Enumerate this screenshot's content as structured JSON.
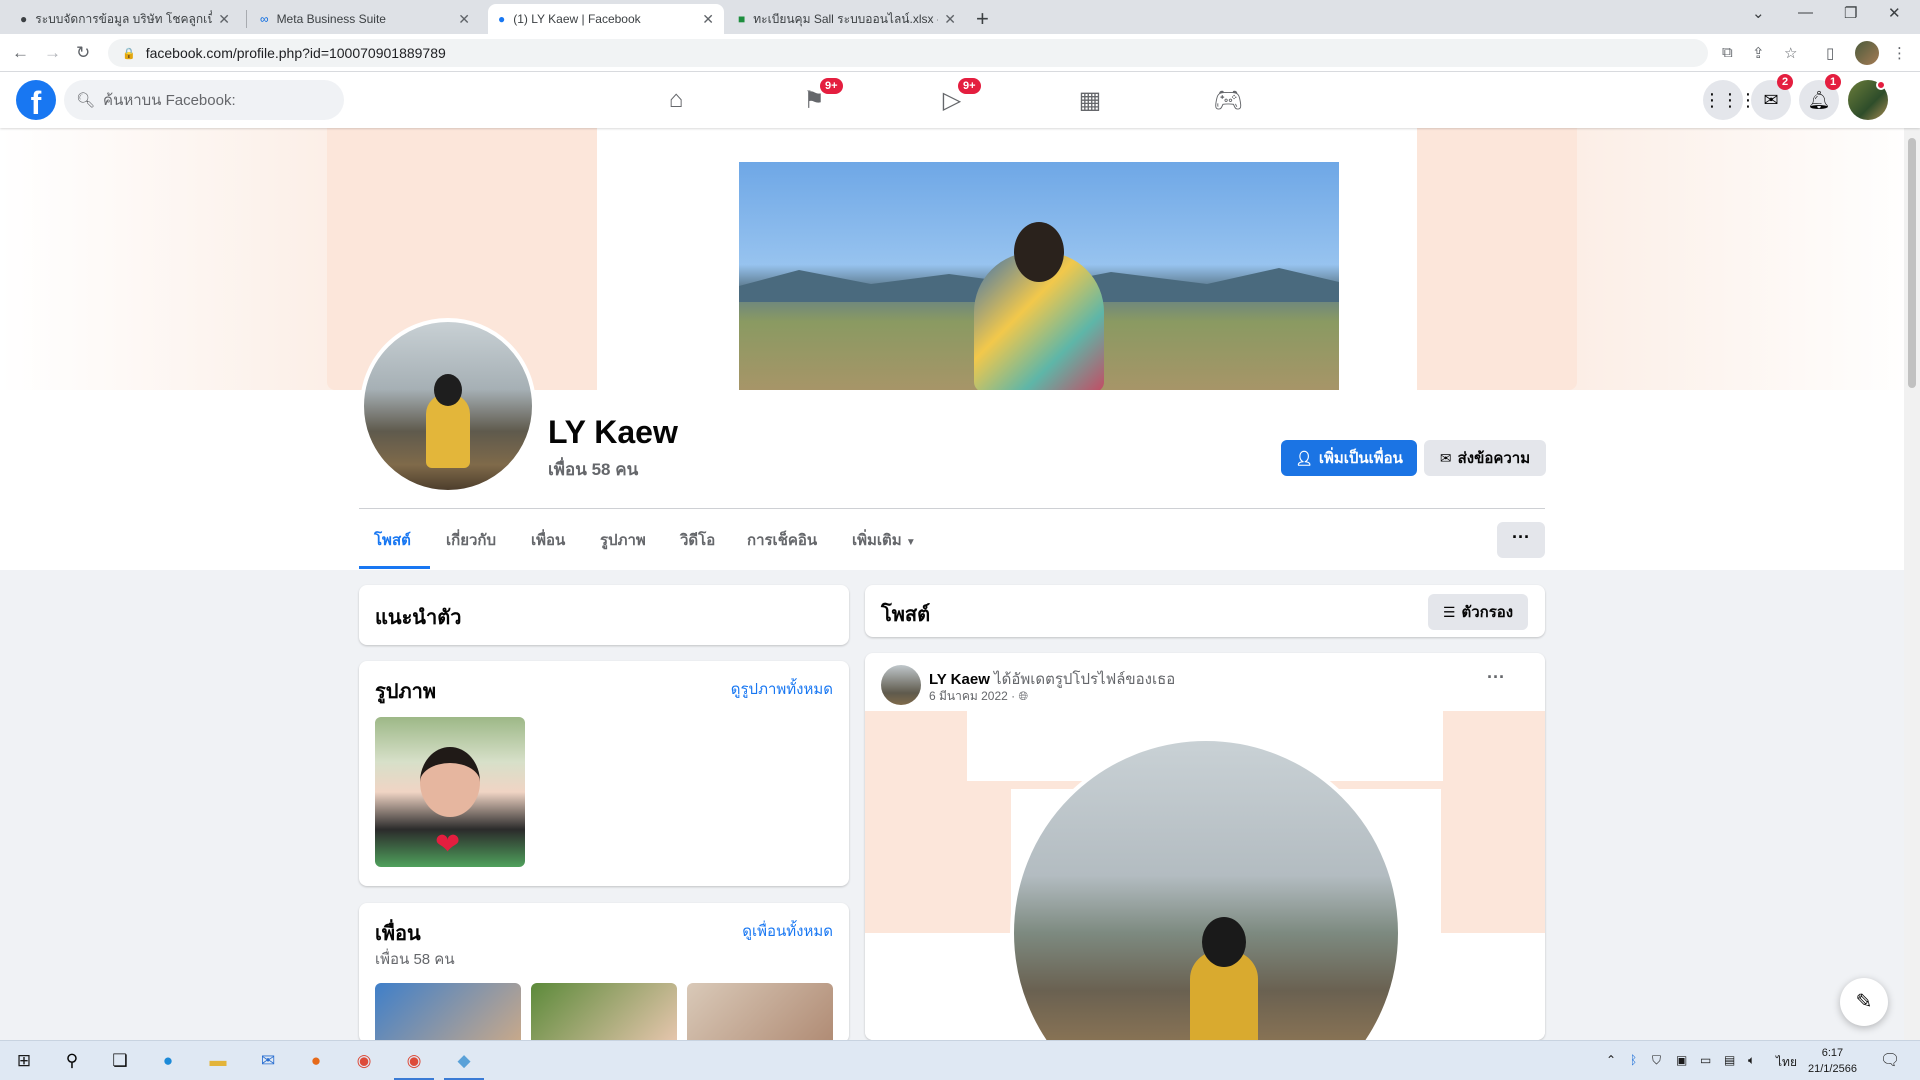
{
  "browser": {
    "tabs": [
      {
        "title": "ระบบจัดการข้อมูล บริษัท โชคลูกเนื้อด ..."
      },
      {
        "title": "Meta Business Suite"
      },
      {
        "title": "(1) LY Kaew | Facebook"
      },
      {
        "title": "ทะเบียนคุม Sall ระบบออนไลน์.xlsx - G"
      }
    ],
    "url": "facebook.com/profile.php?id=100070901889789"
  },
  "fb": {
    "search_placeholder": "ค้นหาบน Facebook:",
    "badges": {
      "pages": "9+",
      "watch": "9+",
      "messenger": "2",
      "notifications": "1"
    }
  },
  "profile": {
    "name": "LY Kaew",
    "friends_count": "เพื่อน 58 คน",
    "add_friend": "เพิ่มเป็นเพื่อน",
    "message": "ส่งข้อความ",
    "tabs": [
      "โพสต์",
      "เกี่ยวกับ",
      "เพื่อน",
      "รูปภาพ",
      "วิดีโอ",
      "การเช็คอิน",
      "เพิ่มเติม"
    ]
  },
  "intro": {
    "title": "แนะนำตัว"
  },
  "photos": {
    "title": "รูปภาพ",
    "see_all": "ดูรูปภาพทั้งหมด"
  },
  "friends": {
    "title": "เพื่อน",
    "count": "เพื่อน 58 คน",
    "see_all": "ดูเพื่อนทั้งหมด"
  },
  "posts": {
    "title": "โพสต์",
    "filter": "ตัวกรอง"
  },
  "post": {
    "author": "LY Kaew",
    "action": "ได้อัพเดตรูปโปรไฟล์ของเธอ",
    "date": "6 มีนาคม 2022 ·"
  },
  "taskbar": {
    "lang": "ไทย",
    "time": "6:17",
    "date": "21/1/2566"
  },
  "colors": {
    "accent": "#1877f2",
    "badge": "#e41e3f"
  }
}
